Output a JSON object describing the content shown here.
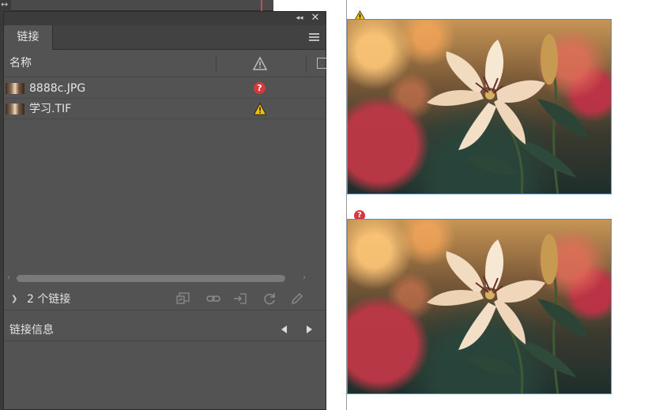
{
  "panel": {
    "tab_label": "链接",
    "column_name": "名称",
    "rows": [
      {
        "filename": "8888c.JPG",
        "status": "missing",
        "status_glyph": "?"
      },
      {
        "filename": "学习.TIF",
        "status": "modified"
      }
    ],
    "link_count": "2 个链接",
    "info_label": "链接信息"
  },
  "canvas": {
    "frames": [
      {
        "status": "modified"
      },
      {
        "status": "missing",
        "status_glyph": "?"
      }
    ]
  },
  "colors": {
    "panel_bg": "#535353",
    "warning": "#f2c200",
    "missing": "#d9383a",
    "frame_border": "#4a8ed6"
  },
  "icons": [
    "collapse-icon",
    "close-icon",
    "panel-menu-icon",
    "warning-icon",
    "page-icon",
    "missing-link-icon",
    "relink-folder-icon",
    "chain-link-icon",
    "go-to-link-icon",
    "update-link-icon",
    "edit-original-icon",
    "prev-icon",
    "next-icon"
  ]
}
